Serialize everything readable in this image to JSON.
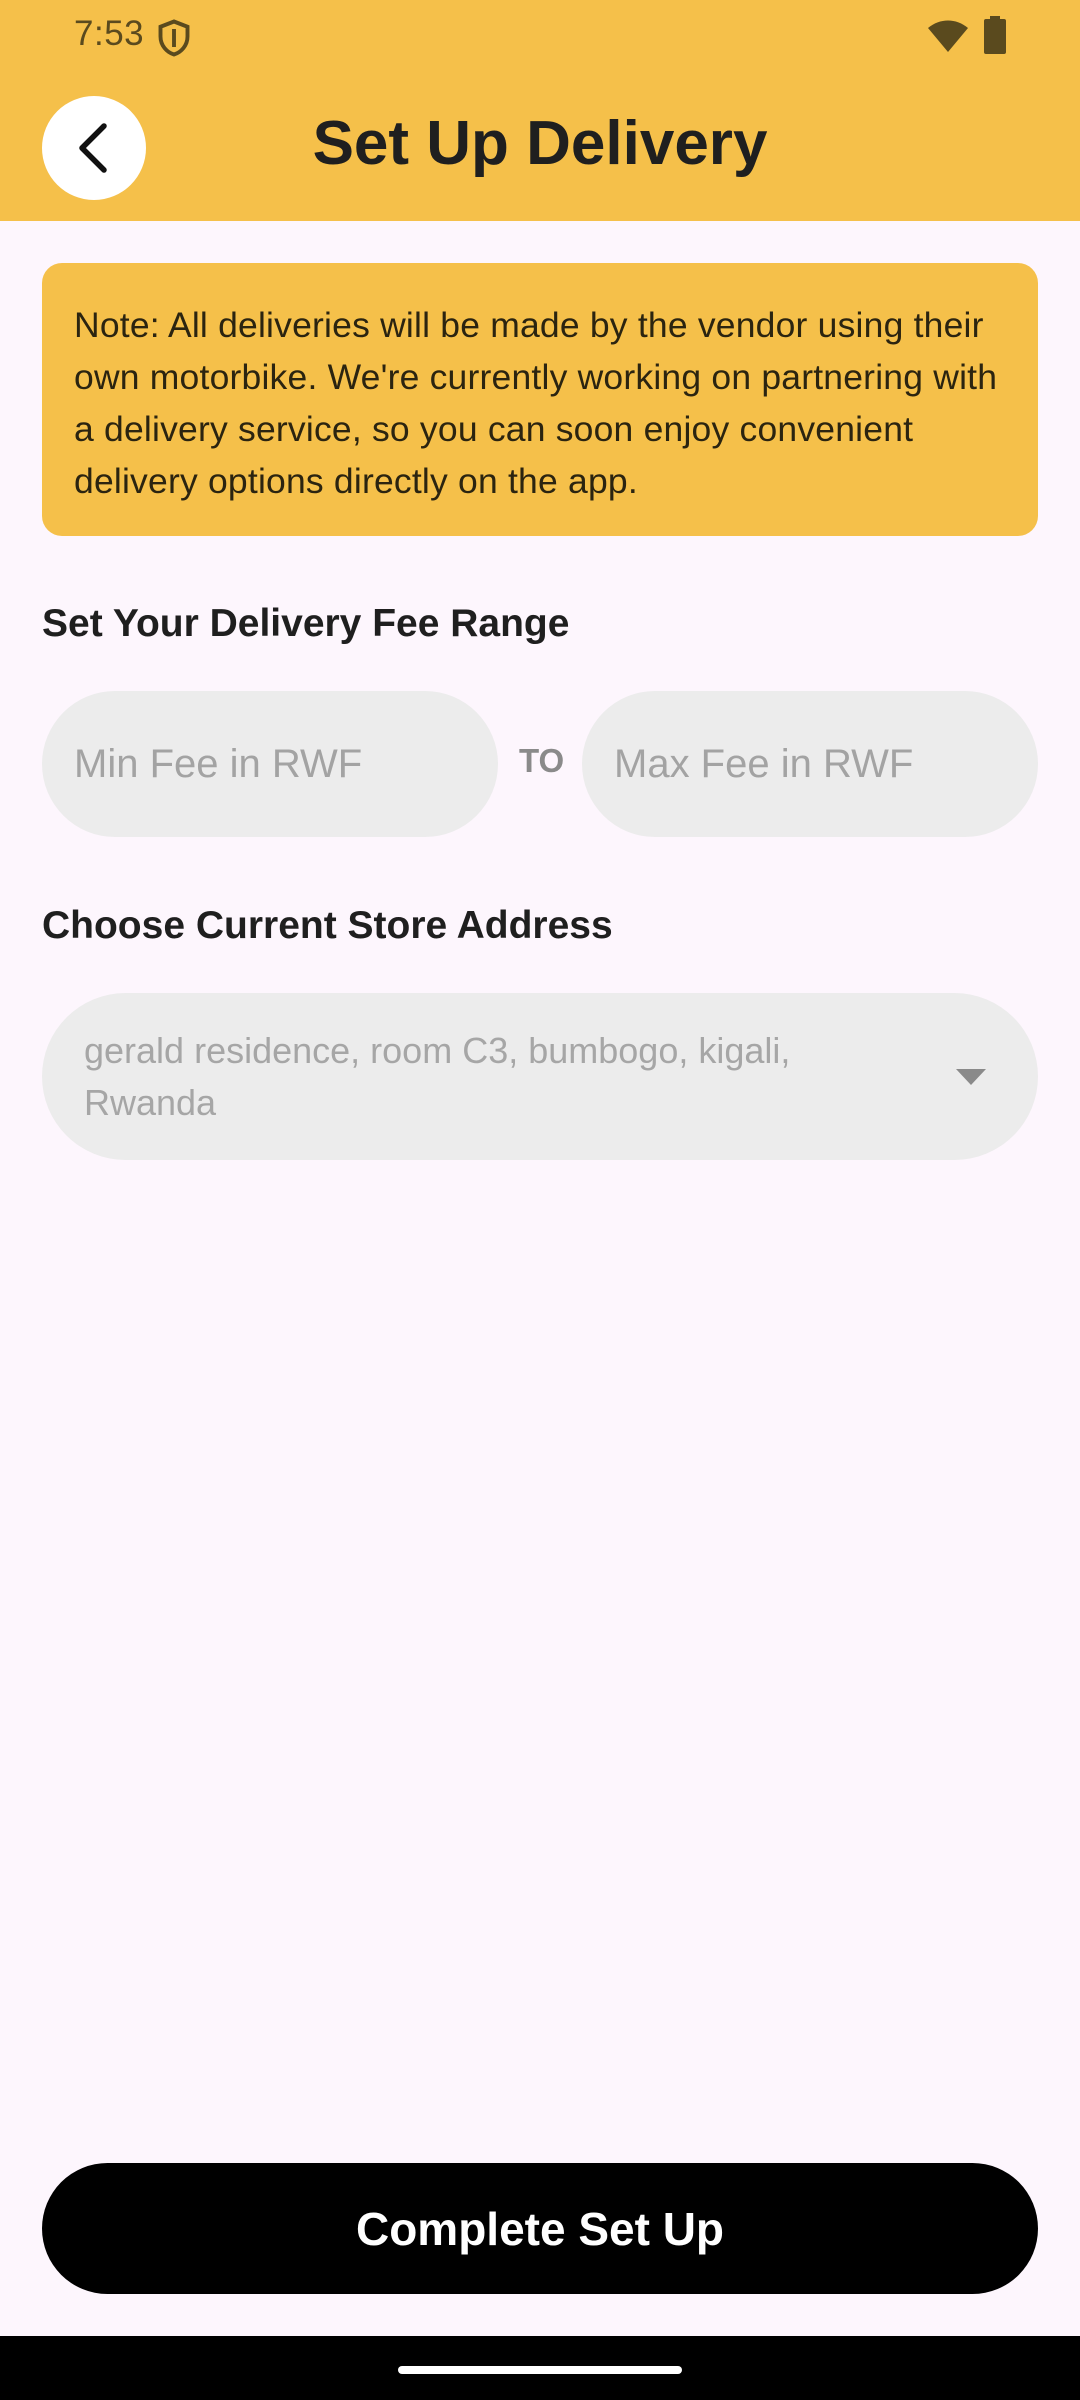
{
  "status_bar": {
    "time": "7:53"
  },
  "header": {
    "title": "Set Up Delivery",
    "back_icon": "chevron-left-icon"
  },
  "note": {
    "text": "Note: All deliveries will be made by the vendor using their own motorbike. We're currently working on partnering with a delivery service, so you can soon enjoy convenient delivery options directly on the app."
  },
  "fee_range": {
    "label": "Set Your Delivery Fee Range",
    "min_placeholder": "Min Fee in RWF",
    "separator": "TO",
    "max_placeholder": "Max Fee in RWF"
  },
  "store_address": {
    "label": "Choose Current Store Address",
    "selected_value": "gerald residence, room C3, bumbogo, kigali, Rwanda"
  },
  "footer": {
    "complete_label": "Complete Set Up"
  },
  "colors": {
    "accent": "#f5c04a",
    "background": "#fdf6fd",
    "input_fill": "#ececec",
    "button": "#000000"
  }
}
